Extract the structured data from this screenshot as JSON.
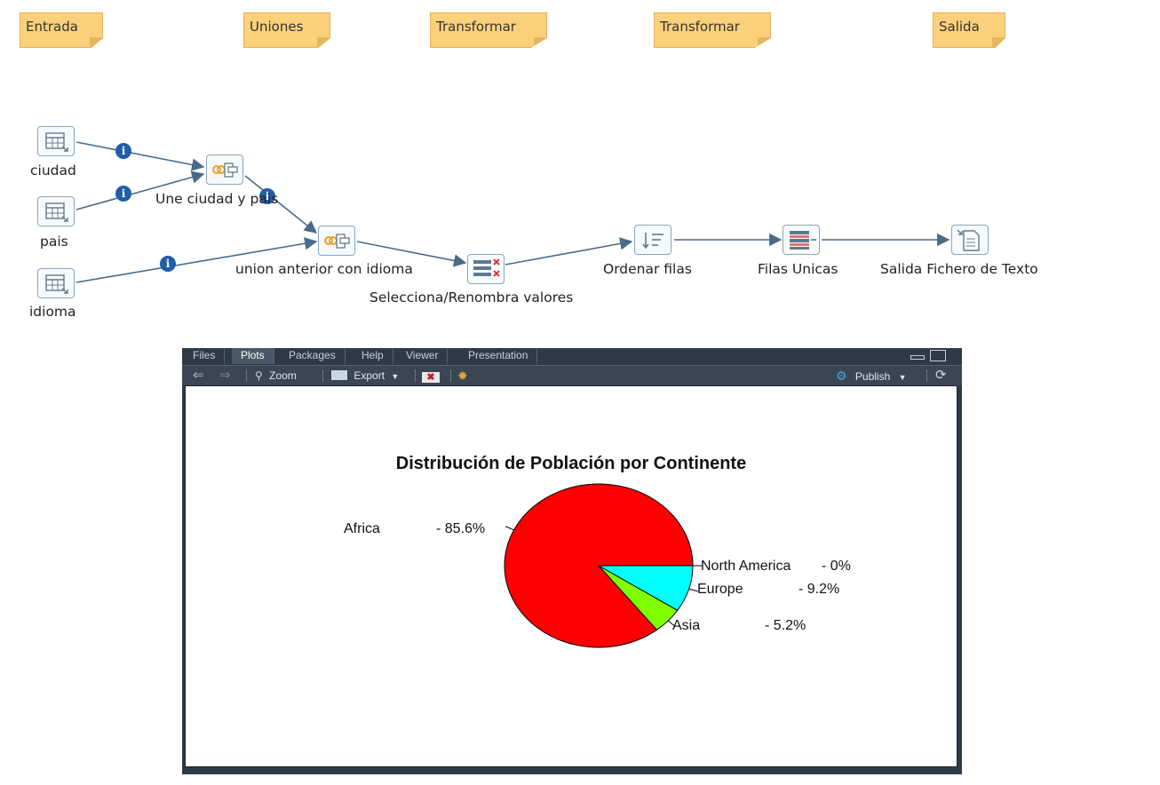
{
  "notes": [
    {
      "label": "Entrada"
    },
    {
      "label": "Uniones"
    },
    {
      "label": "Transformar"
    },
    {
      "label": "Transformar"
    },
    {
      "label": "Salida"
    }
  ],
  "steps": {
    "ciudad": "ciudad",
    "pais": "pais",
    "idioma": "idioma",
    "join1": "Une ciudad y pais",
    "join2": "union anterior con idioma",
    "select": "Selecciona/Renombra valores",
    "sort": "Ordenar filas",
    "unique": "Filas Unicas",
    "output": "Salida Fichero de Texto"
  },
  "badge_glyph": "i",
  "rpane": {
    "tabs": [
      "Files",
      "Plots",
      "Packages",
      "Help",
      "Viewer",
      "Presentation"
    ],
    "active_tab": "Plots",
    "toolbar": {
      "zoom_label": "Zoom",
      "export_label": "Export",
      "publish_label": "Publish"
    }
  },
  "colors": {
    "africa": "#ff0000",
    "asia": "#80ff00",
    "europe": "#00ffff",
    "north_america": "#0000ff",
    "note": "#fbd07a",
    "flow_line": "#4a6a8a"
  },
  "chart_data": {
    "type": "pie",
    "title": "Distribución de Población por Continente",
    "slices": [
      {
        "label": "Africa",
        "value": 85.6,
        "pct_label": "- 85.6%"
      },
      {
        "label": "Asia",
        "value": 5.2,
        "pct_label": "- 5.2%"
      },
      {
        "label": "Europe",
        "value": 9.2,
        "pct_label": "- 9.2%"
      },
      {
        "label": "North America",
        "value": 0,
        "pct_label": "- 0%"
      }
    ]
  }
}
